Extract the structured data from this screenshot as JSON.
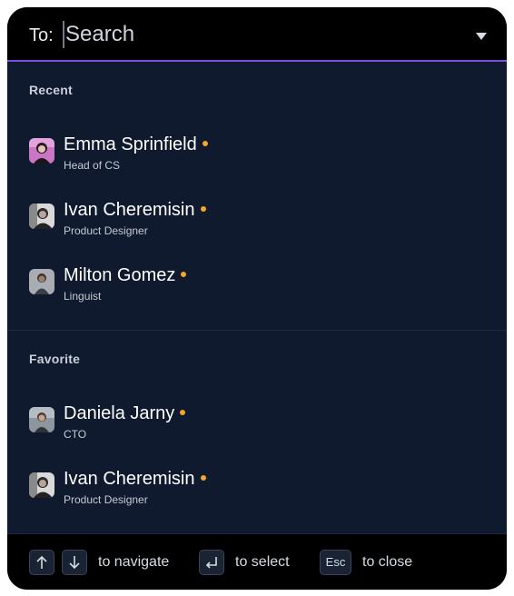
{
  "search": {
    "to_label": "To:",
    "placeholder": "Search"
  },
  "sections": {
    "recent": {
      "title": "Recent",
      "items": [
        {
          "name": "Emma Sprinfield",
          "role": "Head of CS",
          "status": "online"
        },
        {
          "name": "Ivan Cheremisin",
          "role": "Product Designer",
          "status": "online"
        },
        {
          "name": "Milton Gomez",
          "role": "Linguist",
          "status": "online"
        }
      ]
    },
    "favorite": {
      "title": "Favorite",
      "items": [
        {
          "name": "Daniela Jarny",
          "role": "CTO",
          "status": "online"
        },
        {
          "name": "Ivan Cheremisin",
          "role": "Product Designer",
          "status": "online"
        }
      ]
    }
  },
  "footer": {
    "navigate_hint": "to navigate",
    "select_hint": "to select",
    "esc_key": "Esc",
    "close_hint": "to close"
  },
  "colors": {
    "panel_bg": "#101a2e",
    "header_bg": "#000000",
    "accent_line": "#7c4ddc",
    "status_dot": "#f5a623"
  },
  "icons": [
    "dropdown-arrow-icon",
    "arrow-up-icon",
    "arrow-down-icon",
    "enter-icon"
  ]
}
